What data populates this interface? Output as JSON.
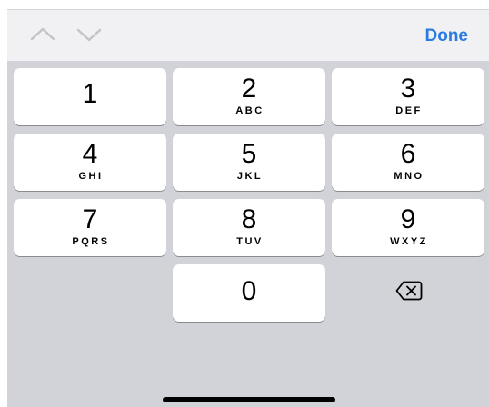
{
  "accessory_bar": {
    "prev_icon": "chevron-up-icon",
    "next_icon": "chevron-down-icon",
    "done_label": "Done",
    "accent_color": "#2a7ae2"
  },
  "keypad": {
    "keys": [
      {
        "digit": "1",
        "letters": ""
      },
      {
        "digit": "2",
        "letters": "ABC"
      },
      {
        "digit": "3",
        "letters": "DEF"
      },
      {
        "digit": "4",
        "letters": "GHI"
      },
      {
        "digit": "5",
        "letters": "JKL"
      },
      {
        "digit": "6",
        "letters": "MNO"
      },
      {
        "digit": "7",
        "letters": "PQRS"
      },
      {
        "digit": "8",
        "letters": "TUV"
      },
      {
        "digit": "9",
        "letters": "WXYZ"
      },
      {
        "digit": "0",
        "letters": ""
      }
    ],
    "delete_icon": "backspace-icon",
    "background_color": "#d1d3d9",
    "key_color": "#ffffff"
  }
}
